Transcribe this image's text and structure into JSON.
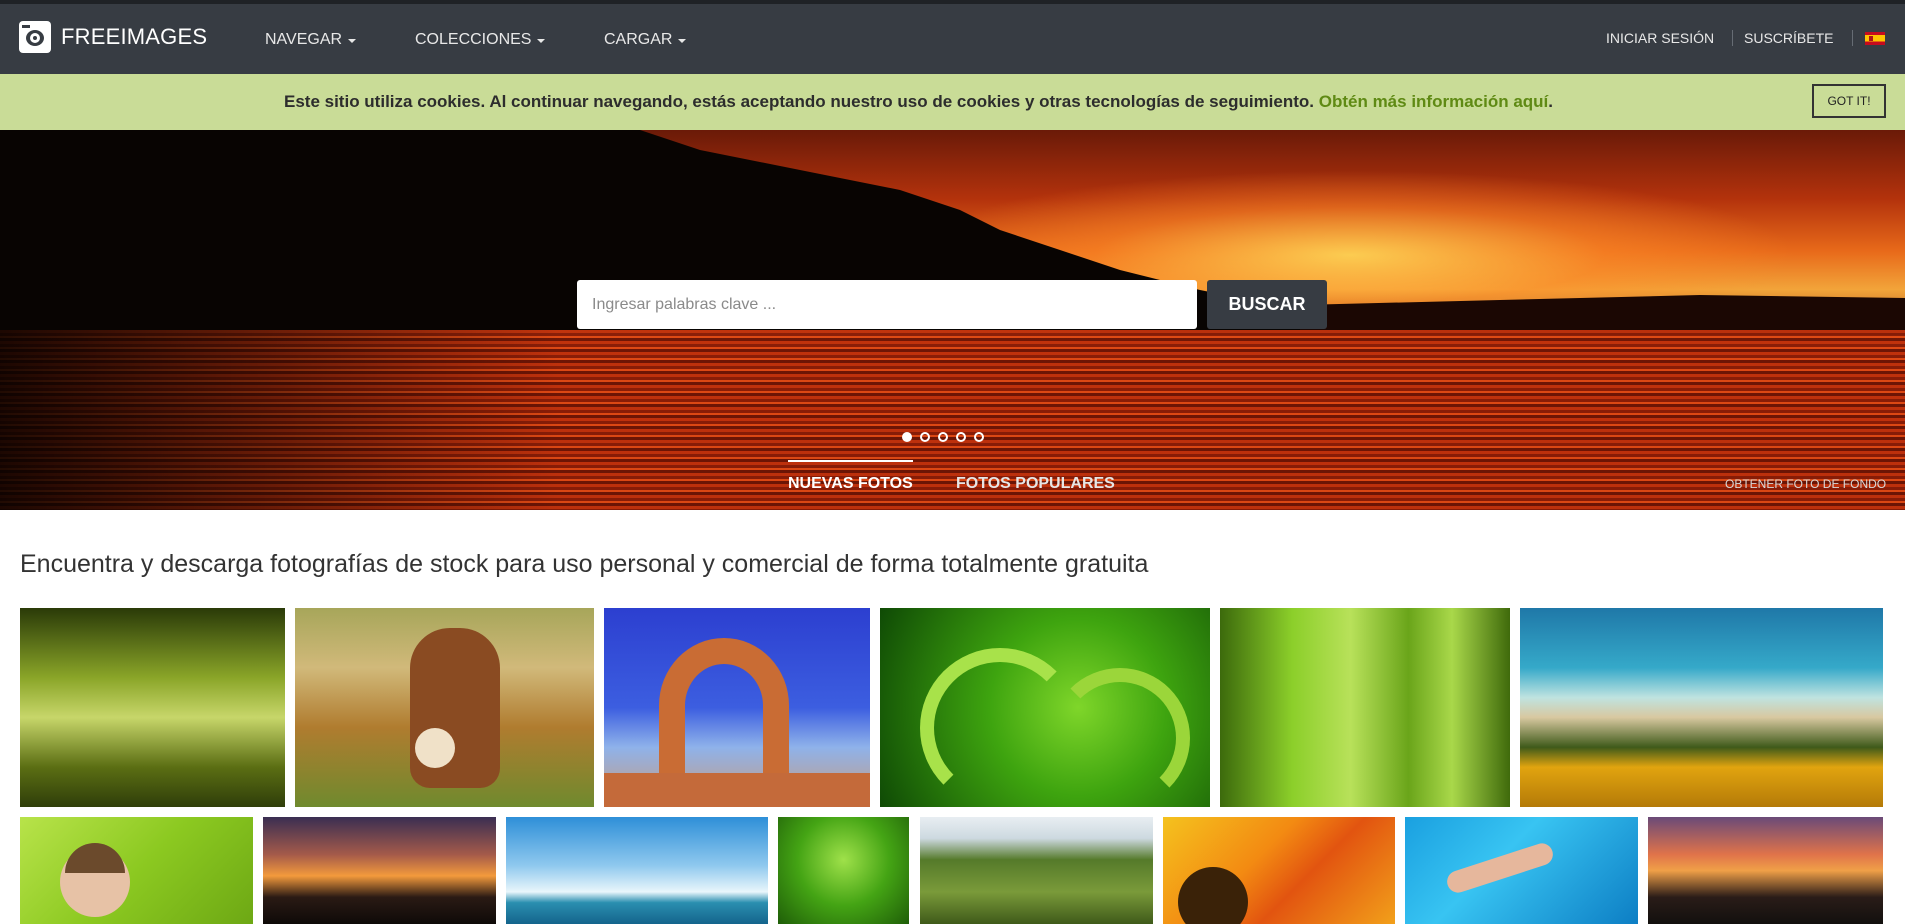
{
  "header": {
    "logo_text": "FREEIMAGES",
    "nav": [
      {
        "label": "NAVEGAR"
      },
      {
        "label": "COLECCIONES"
      },
      {
        "label": "CARGAR"
      }
    ],
    "login_label": "INICIAR SESIÓN",
    "subscribe_label": "SUSCRÍBETE",
    "language_flag": "es-flag-icon"
  },
  "cookie_bar": {
    "text": "Este sitio utiliza cookies. Al continuar navegando, estás aceptando nuestro uso de cookies y otras tecnologías de seguimiento. ",
    "link_text": "Obtén más información aquí",
    "period": ".",
    "button_label": "GOT IT!",
    "background": "#c9dc97",
    "link_color": "#5f8a14"
  },
  "hero": {
    "search_placeholder": "Ingresar palabras clave ...",
    "search_button": "BUSCAR",
    "slides_count": 5,
    "active_slide": 1,
    "tabs": [
      {
        "label": "NUEVAS FOTOS",
        "active": true
      },
      {
        "label": "FOTOS POPULARES",
        "active": false
      }
    ],
    "background_link": "OBTENER FOTO DE FONDO"
  },
  "main": {
    "title": "Encuentra y descarga fotografías de stock para uso personal y comercial de forma totalmente gratuita"
  },
  "colors": {
    "topbar": "#373c43",
    "accent_green": "#5f8a14"
  }
}
